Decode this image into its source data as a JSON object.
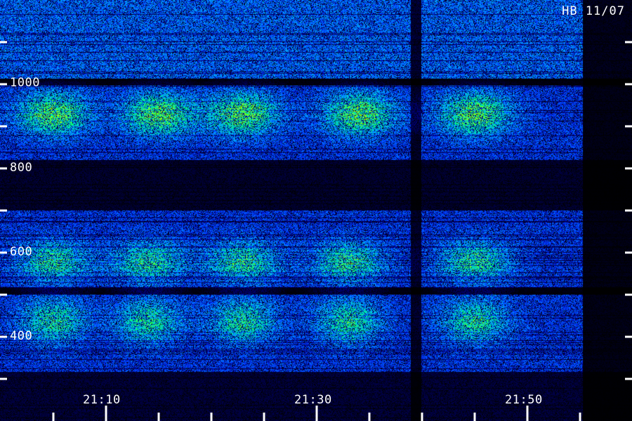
{
  "chart_data": {
    "type": "heatmap",
    "title": "HB 11/07",
    "x_tick_labels": [
      "21:10",
      "21:30",
      "21:50"
    ],
    "y_tick_labels": [
      "1000",
      "800",
      "600",
      "400"
    ],
    "colormap": [
      "#000000",
      "#0000a0",
      "#0040ff",
      "#00a0ff",
      "#00e0c0",
      "#00ff60",
      "#a0ff00"
    ],
    "bursts": [
      {
        "band": "upper",
        "times": [
          "21:06",
          "21:16",
          "21:24",
          "21:35",
          "21:46"
        ]
      },
      {
        "band": "middle",
        "times": [
          "21:06",
          "21:15",
          "21:24",
          "21:34",
          "21:46"
        ]
      },
      {
        "band": "lower",
        "times": [
          "21:06",
          "21:15",
          "21:24",
          "21:34",
          "21:46"
        ]
      }
    ],
    "grid": false,
    "legend": "none"
  }
}
